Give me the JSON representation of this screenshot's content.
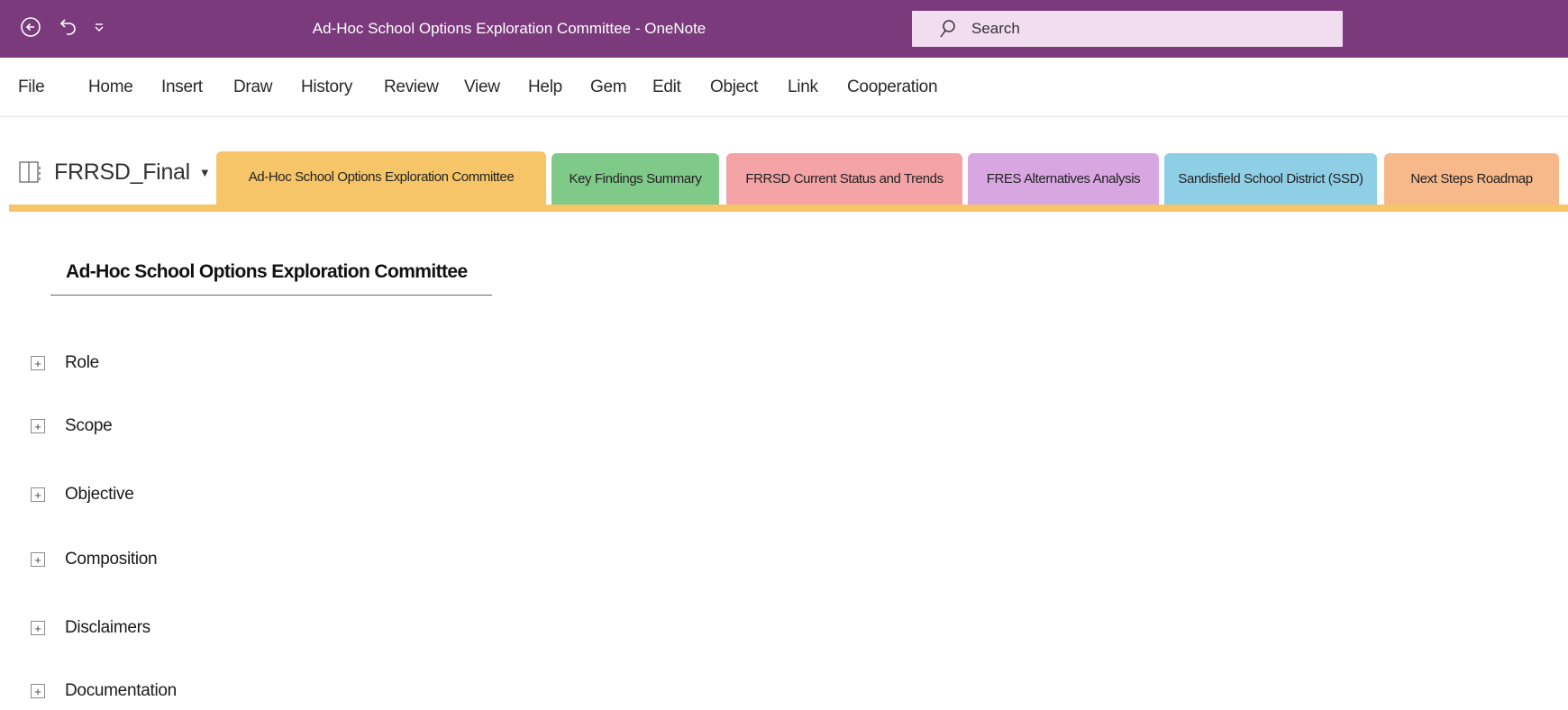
{
  "window": {
    "title": "Ad-Hoc School Options Exploration Committee  -  OneNote",
    "search_placeholder": "Search",
    "title_bar_color": "#7b3a7c"
  },
  "quick_access": {
    "back_icon": "back-arrow-icon",
    "undo_icon": "undo-icon",
    "customize_icon": "customize-quick-access-icon"
  },
  "menu": {
    "items": [
      "File",
      "Home",
      "Insert",
      "Draw",
      "History",
      "Review",
      "View",
      "Help",
      "Gem",
      "Edit",
      "Object",
      "Link",
      "Cooperation"
    ]
  },
  "notebook": {
    "name": "FRRSD_Final",
    "icon": "notebook-icon"
  },
  "sections": [
    {
      "label": "Ad-Hoc School Options Exploration Committee",
      "color": "#f6c567",
      "active": true
    },
    {
      "label": "Key Findings Summary",
      "color": "#7fca88"
    },
    {
      "label": "FRRSD Current Status and Trends",
      "color": "#f4a3a6"
    },
    {
      "label": "FRES Alternatives Analysis",
      "color": "#d8a7e2"
    },
    {
      "label": "Sandisfield School District (SSD)",
      "color": "#8fcfe6"
    },
    {
      "label": "Next Steps Roadmap",
      "color": "#f7b98a"
    }
  ],
  "page": {
    "title": "Ad-Hoc School Options Exploration Committee",
    "outline": [
      {
        "label": "Role",
        "expander": "+"
      },
      {
        "label": "Scope",
        "expander": "+"
      },
      {
        "label": "Objective",
        "expander": "+"
      },
      {
        "label": "Composition",
        "expander": "+"
      },
      {
        "label": "Disclaimers",
        "expander": "+"
      },
      {
        "label": "Documentation",
        "expander": "+"
      }
    ]
  }
}
